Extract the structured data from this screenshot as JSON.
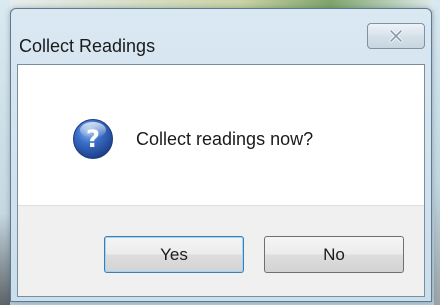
{
  "window": {
    "title": "Collect Readings"
  },
  "dialog": {
    "message": "Collect readings now?",
    "icon": "question-icon"
  },
  "buttons": {
    "yes_label": "Yes",
    "no_label": "No",
    "close_icon": "close-icon"
  },
  "colors": {
    "question_icon_blue": "#2b5fb4",
    "button_area_bg": "#f0f0f0",
    "frame_bg": "#d3e3ee"
  }
}
